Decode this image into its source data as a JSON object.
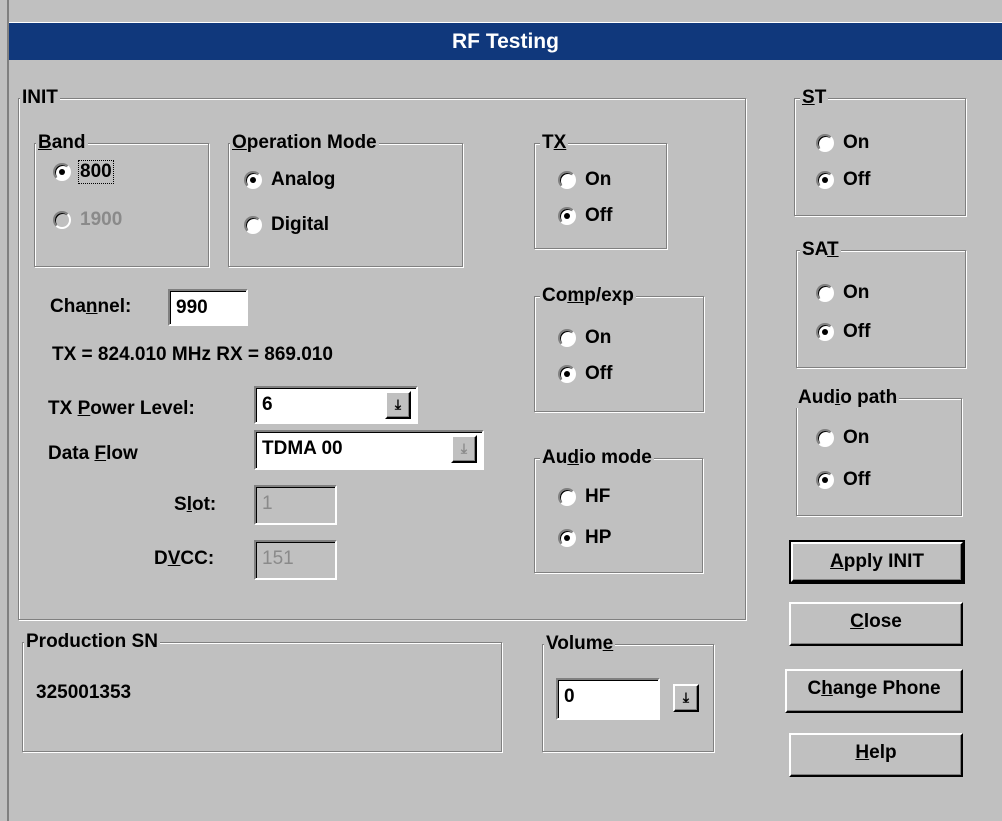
{
  "window": {
    "title": "RF Testing"
  },
  "init": {
    "legend": "INIT",
    "band": {
      "legend_pre": "",
      "legend_ul": "B",
      "legend_post": "and",
      "options": [
        {
          "label": "800",
          "selected": true,
          "enabled": true
        },
        {
          "label": "1900",
          "selected": false,
          "enabled": false
        }
      ]
    },
    "operation_mode": {
      "legend_pre": "",
      "legend_ul": "O",
      "legend_post": "peration Mode",
      "options": [
        {
          "label": "Analog",
          "selected": true
        },
        {
          "label": "Digital",
          "selected": false
        }
      ]
    },
    "tx": {
      "legend_pre": "T",
      "legend_ul": "X",
      "legend_post": "",
      "options": [
        {
          "label": "On",
          "selected": false
        },
        {
          "label": "Off",
          "selected": true
        }
      ]
    },
    "comp_exp": {
      "legend_pre": "Co",
      "legend_ul": "m",
      "legend_post": "p/exp",
      "options": [
        {
          "label": "On",
          "selected": false
        },
        {
          "label": "Off",
          "selected": true
        }
      ]
    },
    "audio_mode": {
      "legend_pre": "Au",
      "legend_ul": "d",
      "legend_post": "io mode",
      "options": [
        {
          "label": "HF",
          "selected": false
        },
        {
          "label": "HP",
          "selected": true
        }
      ]
    },
    "channel": {
      "label_pre": "Cha",
      "label_ul": "n",
      "label_post": "nel:",
      "value": "990"
    },
    "freq_text": "TX = 824.010 MHz RX = 869.010",
    "tx_power": {
      "label_pre": "TX ",
      "label_ul": "P",
      "label_post": "ower Level:",
      "value": "6",
      "arrow": "down-arrow-icon"
    },
    "data_flow": {
      "label_pre": "Data ",
      "label_ul": "F",
      "label_post": "low",
      "value": "TDMA 00",
      "arrow": "disabled-down-arrow-icon"
    },
    "slot": {
      "label_pre": "S",
      "label_ul": "l",
      "label_post": "ot:",
      "value": "1"
    },
    "dvcc": {
      "label_pre": "D",
      "label_ul": "V",
      "label_post": "CC:",
      "value": "151"
    }
  },
  "st": {
    "legend_pre": "",
    "legend_ul": "S",
    "legend_post": "T",
    "options": [
      {
        "label": "On",
        "selected": false
      },
      {
        "label": "Off",
        "selected": true
      }
    ]
  },
  "sat": {
    "legend_pre": "SA",
    "legend_ul": "T",
    "legend_post": "",
    "options": [
      {
        "label": "On",
        "selected": false
      },
      {
        "label": "Off",
        "selected": true
      }
    ]
  },
  "audio_path": {
    "legend_pre": "Aud",
    "legend_ul": "i",
    "legend_post": "o path",
    "options": [
      {
        "label": "On",
        "selected": false
      },
      {
        "label": "Off",
        "selected": true
      }
    ]
  },
  "production_sn": {
    "legend": "Production SN",
    "value": "325001353"
  },
  "volume": {
    "legend_pre": "Volum",
    "legend_ul": "e",
    "legend_post": "",
    "value": "0",
    "arrow": "down-arrow-icon"
  },
  "buttons": {
    "apply_init": {
      "pre": "",
      "ul": "A",
      "post": "pply INIT"
    },
    "close": {
      "pre": "",
      "ul": "C",
      "post": "lose"
    },
    "change_phone": {
      "pre": "C",
      "ul": "h",
      "post": "ange Phone"
    },
    "help": {
      "pre": "",
      "ul": "H",
      "post": "elp"
    }
  }
}
